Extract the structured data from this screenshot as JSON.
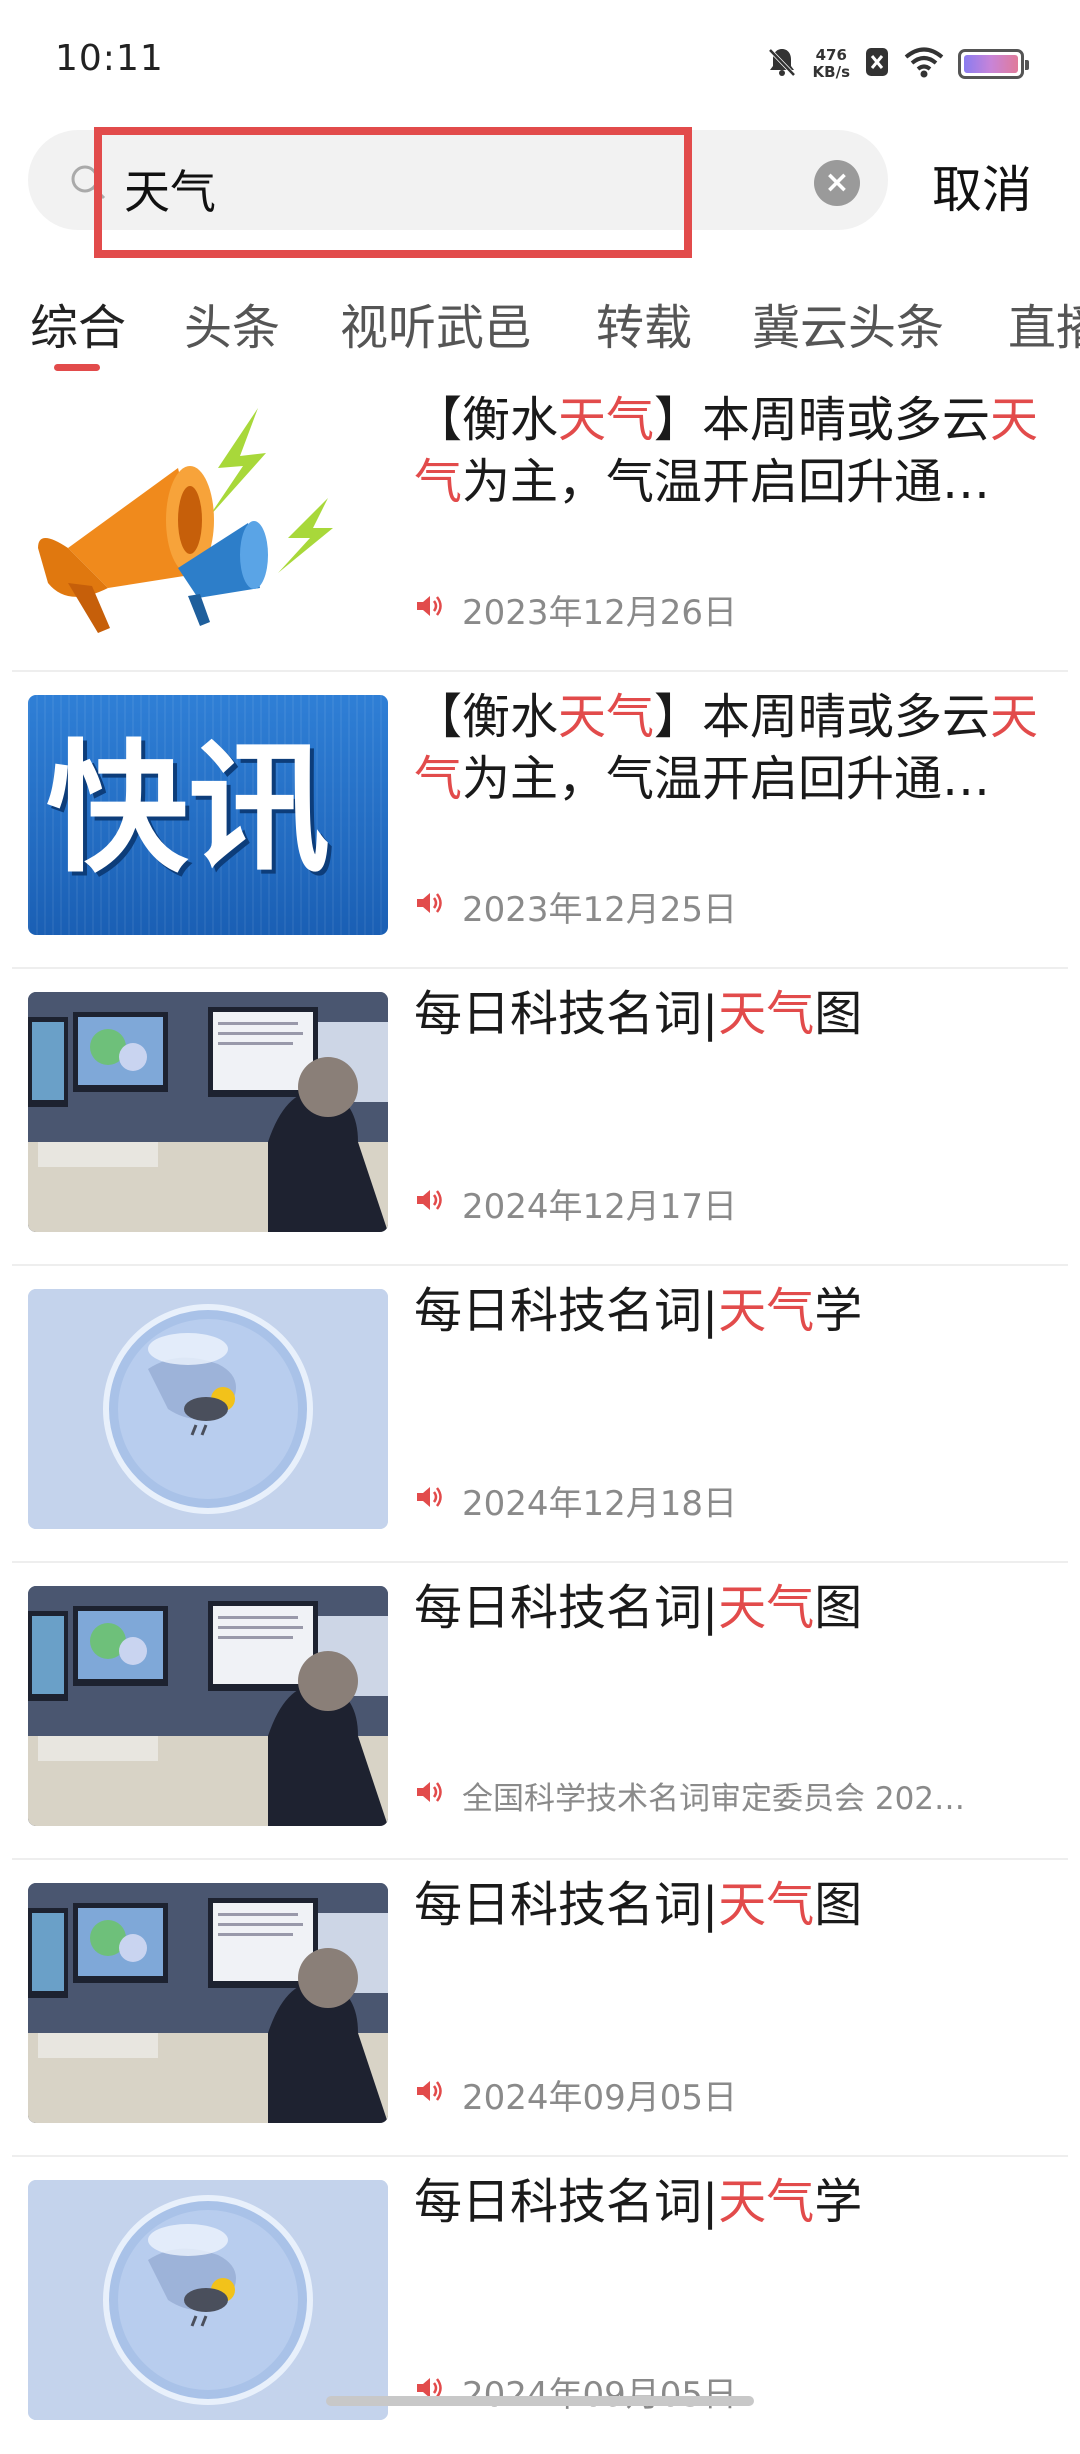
{
  "status": {
    "time": "10:11",
    "net_speed_value": "476",
    "net_speed_unit": "KB/s"
  },
  "search": {
    "query": "天气",
    "cancel_label": "取消"
  },
  "tabs": [
    {
      "label": "综合",
      "active": true
    },
    {
      "label": "头条",
      "active": false
    },
    {
      "label": "视听武邑",
      "active": false
    },
    {
      "label": "转载",
      "active": false
    },
    {
      "label": "冀云头条",
      "active": false
    },
    {
      "label": "直播",
      "active": false
    }
  ],
  "items": [
    {
      "title_pre": "【衡水",
      "title_kw": "天气",
      "title_post": "】本周晴或多云",
      "title_kw2": "天气",
      "title_post2": "为主，气温开启回升通…",
      "meta": "2023年12月26日",
      "thumb": "megaphone"
    },
    {
      "title_pre": "【衡水",
      "title_kw": "天气",
      "title_post": "】本周晴或多云",
      "title_kw2": "天气",
      "title_post2": "为主，气温开启回升通…",
      "meta": "2023年12月25日",
      "thumb": "kuaixun",
      "thumb_text": "快讯"
    },
    {
      "title_pre": "每日科技名词|",
      "title_kw": "天气",
      "title_post": "图",
      "meta": "2024年12月17日",
      "thumb": "office"
    },
    {
      "title_pre": "每日科技名词|",
      "title_kw": "天气",
      "title_post": "学",
      "meta": "2024年12月18日",
      "thumb": "globe"
    },
    {
      "title_pre": "每日科技名词|",
      "title_kw": "天气",
      "title_post": "图",
      "meta": "全国科学技术名词审定委员会  202…",
      "thumb": "office"
    },
    {
      "title_pre": "每日科技名词|",
      "title_kw": "天气",
      "title_post": "图",
      "meta": "2024年09月05日",
      "thumb": "office"
    },
    {
      "title_pre": "每日科技名词|",
      "title_kw": "天气",
      "title_post": "学",
      "meta": "2024年09月05日",
      "thumb": "globe"
    }
  ],
  "colors": {
    "accent": "#e24b4b"
  }
}
